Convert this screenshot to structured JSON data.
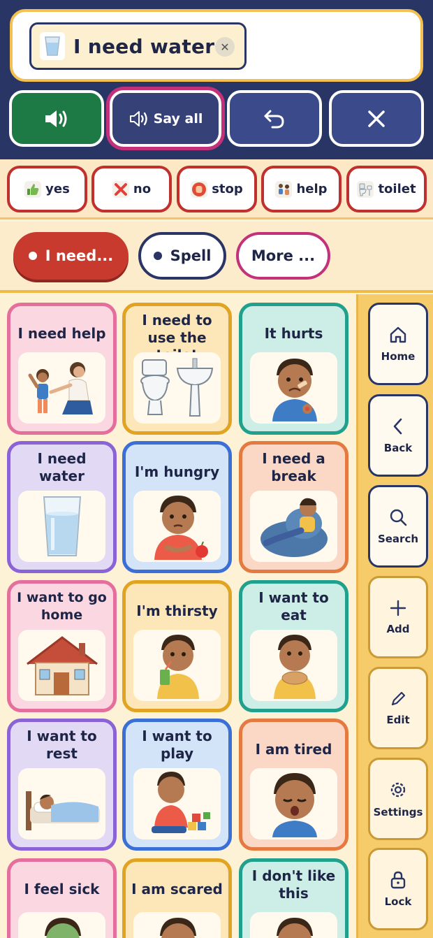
{
  "message": {
    "text": "I need water",
    "icon": "water-glass-icon"
  },
  "controls": {
    "say_all_label": "Say all"
  },
  "quick_words": [
    {
      "label": "yes",
      "icon": "thumbs-up-icon"
    },
    {
      "label": "no",
      "icon": "red-x-icon"
    },
    {
      "label": "stop",
      "icon": "stop-hand-icon"
    },
    {
      "label": "help",
      "icon": "helping-people-icon"
    },
    {
      "label": "toilet",
      "icon": "toilet-icon"
    }
  ],
  "categories": [
    {
      "label": "I need...",
      "selected": true
    },
    {
      "label": "Spell",
      "selected": false
    },
    {
      "label": "More ...",
      "selected": false
    }
  ],
  "sidebar": [
    {
      "label": "Home",
      "icon": "home-icon"
    },
    {
      "label": "Back",
      "icon": "chevron-left-icon"
    },
    {
      "label": "Search",
      "icon": "search-icon"
    },
    {
      "label": "Add",
      "icon": "plus-icon"
    },
    {
      "label": "Edit",
      "icon": "pencil-icon"
    },
    {
      "label": "Settings",
      "icon": "gear-icon"
    },
    {
      "label": "Lock",
      "icon": "lock-icon"
    }
  ],
  "tiles": [
    {
      "label": "I need help",
      "color": "pink"
    },
    {
      "label": "I need to use the toilet",
      "color": "gold"
    },
    {
      "label": "It hurts",
      "color": "teal"
    },
    {
      "label": "I need water",
      "color": "purple"
    },
    {
      "label": "I'm hungry",
      "color": "blue"
    },
    {
      "label": "I need a break",
      "color": "orange"
    },
    {
      "label": "I want to go home",
      "color": "pink"
    },
    {
      "label": "I'm thirsty",
      "color": "gold"
    },
    {
      "label": "I want to eat",
      "color": "teal"
    },
    {
      "label": "I want to rest",
      "color": "purple"
    },
    {
      "label": "I want to play",
      "color": "blue"
    },
    {
      "label": "I am tired",
      "color": "orange"
    },
    {
      "label": "I feel sick",
      "color": "pink"
    },
    {
      "label": "I am scared",
      "color": "gold"
    },
    {
      "label": "I don't like this",
      "color": "teal"
    }
  ],
  "colors": {
    "navy": "#283565",
    "speak_green": "#1e7a44",
    "accent_magenta": "#c2317a",
    "need_red": "#c73a2d",
    "sidebar_gold": "#f6cc6a",
    "page_cream": "#fdf1d6"
  }
}
